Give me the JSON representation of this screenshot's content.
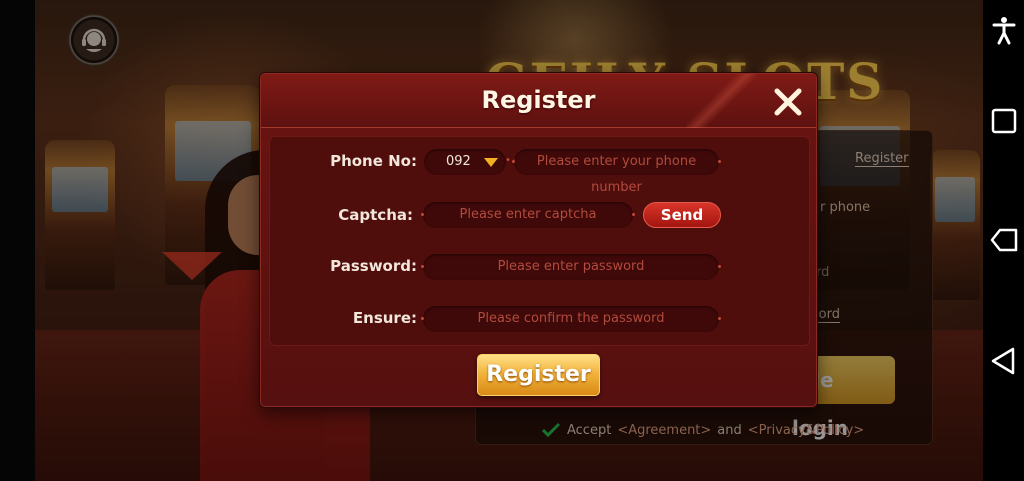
{
  "background": {
    "game_title": "GEILY SLOTS",
    "login_panel": {
      "register_link": "Register",
      "phone_partial": "r phone",
      "word_partial_1": "rd",
      "word_partial_2": "word",
      "login_button_partial": "bile login",
      "accept_text": "Accept",
      "agreement_link": "<Agreement>",
      "and_text": "and",
      "privacy_link": "<Privacy&Policy>"
    }
  },
  "modal": {
    "title": "Register",
    "phone": {
      "label": "Phone No:",
      "country_code": "092",
      "placeholder": "Please enter your phone number"
    },
    "captcha": {
      "label": "Captcha:",
      "placeholder": "Please enter captcha",
      "send_label": "Send"
    },
    "password": {
      "label": "Password:",
      "placeholder": "Please enter password"
    },
    "ensure": {
      "label": "Ensure:",
      "placeholder": "Please confirm the password"
    },
    "register_button": "Register"
  },
  "icons": {
    "support": "headset-icon",
    "close": "close-icon",
    "accessibility": "accessibility-icon",
    "recents": "square-icon",
    "tag": "tag-icon",
    "back": "back-triangle-icon",
    "check": "check-icon"
  },
  "colors": {
    "modal_bg": "#5e110f",
    "accent_gold": "#f2b43c",
    "send_red": "#c8281f",
    "check_green": "#27b34a"
  }
}
